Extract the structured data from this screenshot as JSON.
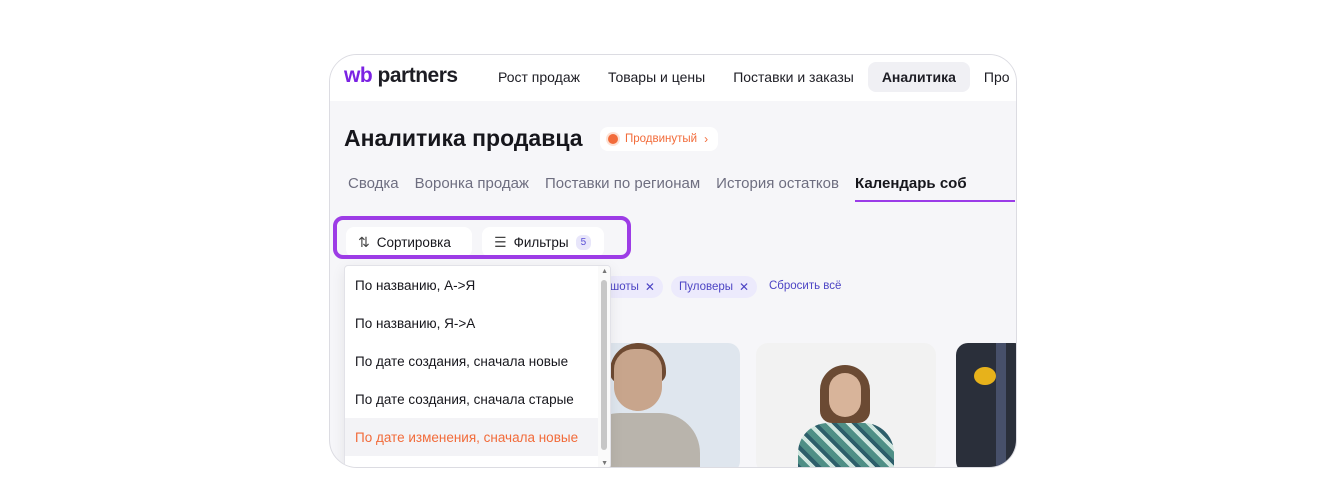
{
  "logo": {
    "wb": "wb",
    "partners": "partners"
  },
  "nav": {
    "items": [
      {
        "label": "Рост продаж"
      },
      {
        "label": "Товары и цены"
      },
      {
        "label": "Поставки и заказы"
      },
      {
        "label": "Аналитика",
        "active": true
      },
      {
        "label": "Про"
      }
    ]
  },
  "page": {
    "title": "Аналитика продавца",
    "badge": "Продвинутый"
  },
  "tabs": [
    {
      "label": "Сводка"
    },
    {
      "label": "Воронка продаж"
    },
    {
      "label": "Поставки по регионам"
    },
    {
      "label": "История остатков"
    },
    {
      "label": "Календарь соб",
      "active": true
    }
  ],
  "toolbar": {
    "sort_label": "Сортировка",
    "filter_label": "Фильтры",
    "filter_count": "5",
    "highlight_color": "#9d3ce6"
  },
  "chips": {
    "items": [
      {
        "label": "шоты"
      },
      {
        "label": "Пуловеры"
      }
    ],
    "reset_label": "Сбросить всё"
  },
  "sort_dropdown": {
    "options": [
      {
        "label": "По названию, А->Я"
      },
      {
        "label": "По названию, Я->А"
      },
      {
        "label": "По дате создания, сначала новые"
      },
      {
        "label": "По дате создания, сначала старые"
      },
      {
        "label": "По дате изменения, сначала новые",
        "selected": true
      }
    ],
    "selected_color": "#f26b3a"
  },
  "colors": {
    "accent": "#7b22e3",
    "orange": "#f26b3a",
    "chip_text": "#4c44c4"
  }
}
